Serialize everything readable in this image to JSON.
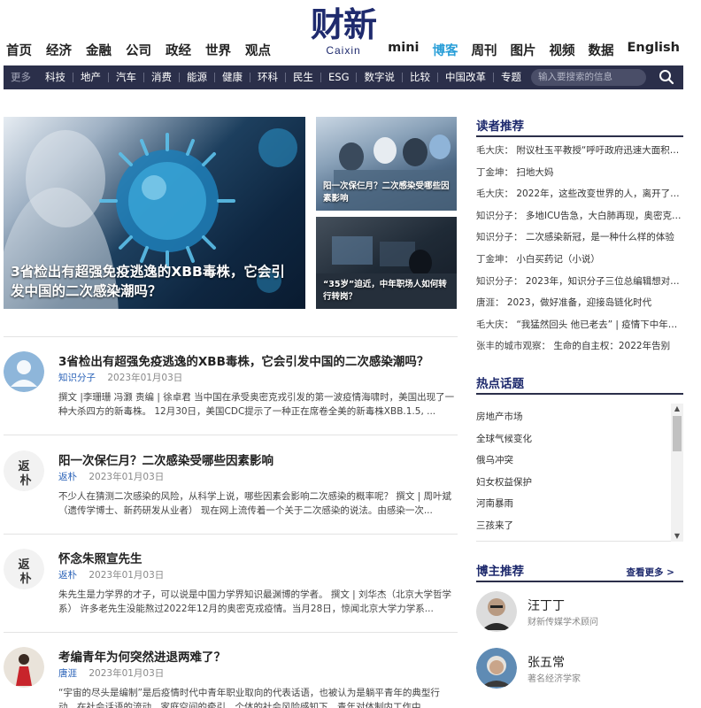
{
  "header": {
    "logo_cn": "财新",
    "logo_en": "Caixin",
    "nav_left": [
      "首页",
      "经济",
      "金融",
      "公司",
      "政经",
      "世界",
      "观点"
    ],
    "nav_right": [
      "mini",
      "博客",
      "周刊",
      "图片",
      "视频",
      "数据",
      "English"
    ],
    "nav_active": "博客"
  },
  "subnav": {
    "more": "更多",
    "items": [
      "科技",
      "地产",
      "汽车",
      "消费",
      "能源",
      "健康",
      "环科",
      "民生",
      "ESG",
      "数字说",
      "比较",
      "中国改革",
      "专题"
    ],
    "search_placeholder": "输入要搜索的信息"
  },
  "featured": {
    "main_caption": "3省检出有超强免疫逃逸的XBB毒株，它会引发中国的二次感染潮吗？",
    "side1_caption": "阳一次保仨月？二次感染受哪些因素影响",
    "side2_caption": "“35岁”迫近，中年职场人如何转行转岗？"
  },
  "articles": [
    {
      "title": "3省检出有超强免疫逃逸的XBB毒株，它会引发中国的二次感染潮吗？",
      "author": "知识分子",
      "date": "2023年01月03日",
      "summary": "撰文 |李珊珊 冯灏 责编 | 徐卓君 当中国在承受奥密克戎引发的第一波疫情海啸时，美国出现了一种大杀四方的新毒株。 12月30日，美国CDC提示了一种正在席卷全美的新毒株XBB.1.5, ..."
    },
    {
      "title": "阳一次保仨月？二次感染受哪些因素影响",
      "author": "返朴",
      "date": "2023年01月03日",
      "summary": "不少人在猜测二次感染的风险，从科学上说，哪些因素会影响二次感染的概率呢？ 撰文 | 周叶斌（遗传学博士、新药研发从业者） 现在网上流传着一个关于二次感染的说法。由感染一次..."
    },
    {
      "title": "怀念朱照宣先生",
      "author": "返朴",
      "date": "2023年01月03日",
      "summary": "朱先生是力学界的才子，可以说是中国力学界知识最渊博的学者。 撰文 | 刘华杰（北京大学哲学系） 许多老先生没能熬过2022年12月的奥密克戎疫情。当月28日，惊闻北京大学力学系..."
    },
    {
      "title": "考编青年为何突然进退两难了？",
      "author": "唐涯",
      "date": "2023年01月03日",
      "summary": "“宇宙的尽头是编制”是后疫情时代中青年职业取向的代表话语，也被认为是躺平青年的典型行动。在社会话语的流动、家庭空间的牵引、个体的社会风险感知下，青年对体制内工作中..."
    }
  ],
  "reader_picks": {
    "title": "读者推荐",
    "items": [
      {
        "source": "毛大庆：",
        "text": "附议杜玉平教授“呼吁政府迅速大面积发放抗原”"
      },
      {
        "source": "丁金坤：",
        "text": "扫地大妈"
      },
      {
        "source": "毛大庆：",
        "text": "2022年，这些改变世界的人，离开了我们"
      },
      {
        "source": "知识分子：",
        "text": "多地ICU告急，大白肺再现，奥密克戎真的变弱了吗"
      },
      {
        "source": "知识分子：",
        "text": "二次感染新冠，是一种什么样的体验"
      },
      {
        "source": "丁金坤：",
        "text": "小白买药记（小说）"
      },
      {
        "source": "知识分子：",
        "text": "2023年，知识分子三位总编辑想对你说"
      },
      {
        "source": "唐涯：",
        "text": "2023，做好准备，迎接岛链化时代"
      },
      {
        "source": "毛大庆：",
        "text": "“我猛然回头 他已老去” | 疫情下中年人的父母"
      },
      {
        "source": "张丰的城市观察：",
        "text": "生命的自主权：2022年告别"
      }
    ]
  },
  "hot_topics": {
    "title": "热点话题",
    "items": [
      "房地产市场",
      "全球气候变化",
      "俄乌冲突",
      "妇女权益保护",
      "河南暴雨",
      "三孩来了"
    ]
  },
  "bloggers": {
    "title": "博主推荐",
    "more": "查看更多 >",
    "items": [
      {
        "name": "汪丁丁",
        "title": "财新传媒学术顾问"
      },
      {
        "name": "张五常",
        "title": "著名经济学家"
      }
    ]
  }
}
